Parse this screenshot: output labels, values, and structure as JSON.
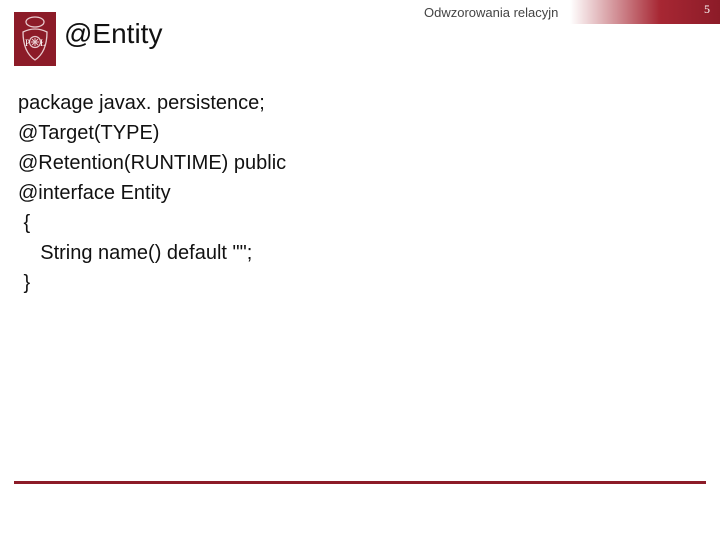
{
  "header": {
    "label": "Odwzorowania relacyjn",
    "page_number": "5"
  },
  "logo": {
    "letter_left": "P",
    "letter_right": "Ł"
  },
  "title": "@Entity",
  "code": {
    "l1": "package javax. persistence;",
    "l2": "@Target(TYPE)",
    "l3": "@Retention(RUNTIME) public",
    "l4": "@interface Entity",
    "l5": " {",
    "l6": "    String name() default \"\";",
    "l7": " }"
  },
  "colors": {
    "accent": "#8c1b28"
  }
}
